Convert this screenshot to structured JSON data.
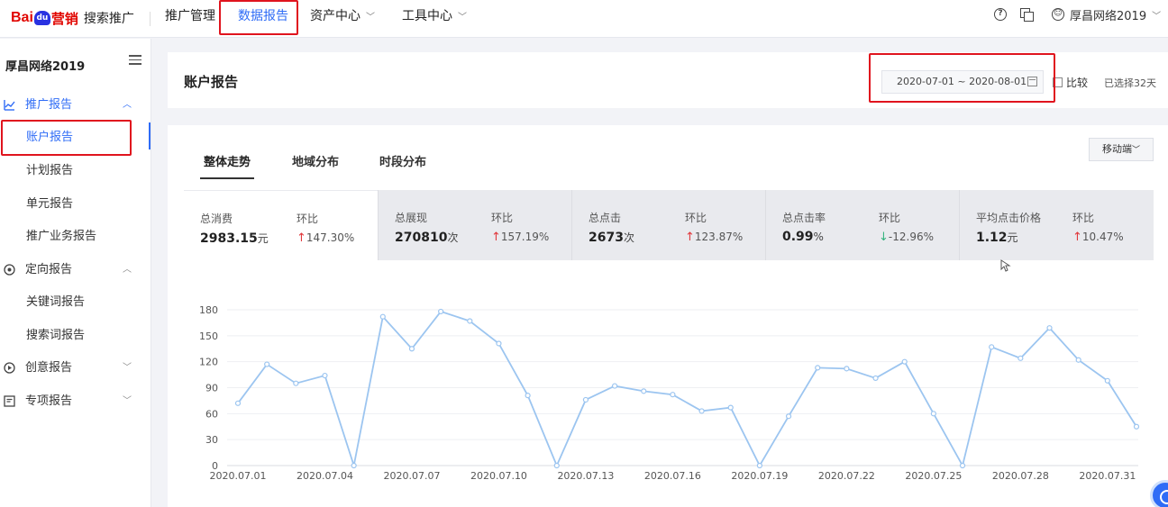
{
  "logo": {
    "bai": "Bai",
    "du": "du",
    "ying": "营销",
    "product": "搜索推广"
  },
  "nav": [
    {
      "label": "推广管理",
      "active": false,
      "dropdown": false
    },
    {
      "label": "数据报告",
      "active": true,
      "dropdown": false
    },
    {
      "label": "资产中心",
      "active": false,
      "dropdown": true
    },
    {
      "label": "工具中心",
      "active": false,
      "dropdown": true
    }
  ],
  "header_right": {
    "help_icon": "question-circle-icon",
    "copy_icon": "copy-icon",
    "user_icon": "user-circle-icon",
    "user_name": "厚昌网络2019"
  },
  "sidebar": {
    "account": "厚昌网络2019",
    "groups": [
      {
        "label": "推广报告",
        "icon": "line-chart-icon",
        "expanded": true,
        "active": true,
        "children": [
          {
            "label": "账户报告",
            "active": true
          },
          {
            "label": "计划报告",
            "active": false
          },
          {
            "label": "单元报告",
            "active": false
          },
          {
            "label": "推广业务报告",
            "active": false
          }
        ]
      },
      {
        "label": "定向报告",
        "icon": "target-icon",
        "expanded": true,
        "active": false,
        "children": [
          {
            "label": "关键词报告",
            "active": false
          },
          {
            "label": "搜索词报告",
            "active": false
          }
        ]
      },
      {
        "label": "创意报告",
        "icon": "play-circle-icon",
        "expanded": false,
        "active": false,
        "children": []
      },
      {
        "label": "专项报告",
        "icon": "report-icon",
        "expanded": false,
        "active": false,
        "children": []
      }
    ]
  },
  "header": {
    "title": "账户报告",
    "date_range": "2020-07-01 ~ 2020-08-01",
    "compare_label": "比较",
    "selected_days": "已选择32天"
  },
  "tabs": [
    {
      "label": "整体走势",
      "active": true
    },
    {
      "label": "地域分布",
      "active": false
    },
    {
      "label": "时段分布",
      "active": false
    }
  ],
  "device_select": "移动端",
  "metrics": [
    {
      "label": "总消费",
      "value": "2983.15",
      "unit": "元",
      "cmp_label": "环比",
      "cmp_value": "147.30%",
      "direction": "up"
    },
    {
      "label": "总展现",
      "value": "270810",
      "unit": "次",
      "cmp_label": "环比",
      "cmp_value": "157.19%",
      "direction": "up"
    },
    {
      "label": "总点击",
      "value": "2673",
      "unit": "次",
      "cmp_label": "环比",
      "cmp_value": "123.87%",
      "direction": "up"
    },
    {
      "label": "总点击率",
      "value": "0.99",
      "unit": "%",
      "cmp_label": "环比",
      "cmp_value": "-12.96%",
      "direction": "down"
    },
    {
      "label": "平均点击价格",
      "value": "1.12",
      "unit": "元",
      "cmp_label": "环比",
      "cmp_value": "10.47%",
      "direction": "up"
    }
  ],
  "colors": {
    "accent": "#2f6cf6",
    "line": "#9cc5f0",
    "up": "#e1363a",
    "down": "#35b37e"
  },
  "chart_data": {
    "type": "line",
    "x": [
      "2020.07.01",
      "2020.07.02",
      "2020.07.03",
      "2020.07.04",
      "2020.07.05",
      "2020.07.06",
      "2020.07.07",
      "2020.07.08",
      "2020.07.09",
      "2020.07.10",
      "2020.07.11",
      "2020.07.12",
      "2020.07.13",
      "2020.07.14",
      "2020.07.15",
      "2020.07.16",
      "2020.07.17",
      "2020.07.18",
      "2020.07.19",
      "2020.07.20",
      "2020.07.21",
      "2020.07.22",
      "2020.07.23",
      "2020.07.24",
      "2020.07.25",
      "2020.07.26",
      "2020.07.27",
      "2020.07.28",
      "2020.07.29",
      "2020.07.30",
      "2020.07.31",
      "2020.08.01"
    ],
    "xticks": [
      "2020.07.01",
      "2020.07.04",
      "2020.07.07",
      "2020.07.10",
      "2020.07.13",
      "2020.07.16",
      "2020.07.19",
      "2020.07.22",
      "2020.07.25",
      "2020.07.28",
      "2020.07.31"
    ],
    "values": [
      72,
      117,
      95,
      104,
      0,
      172,
      135,
      178,
      167,
      141,
      81,
      0,
      76,
      92,
      86,
      82,
      63,
      67,
      0,
      57,
      113,
      112,
      101,
      120,
      60,
      0,
      137,
      124,
      159,
      122,
      98,
      45
    ],
    "yticks": [
      0,
      30,
      60,
      90,
      120,
      150,
      180
    ],
    "ylim": [
      0,
      180
    ],
    "grid": true
  }
}
